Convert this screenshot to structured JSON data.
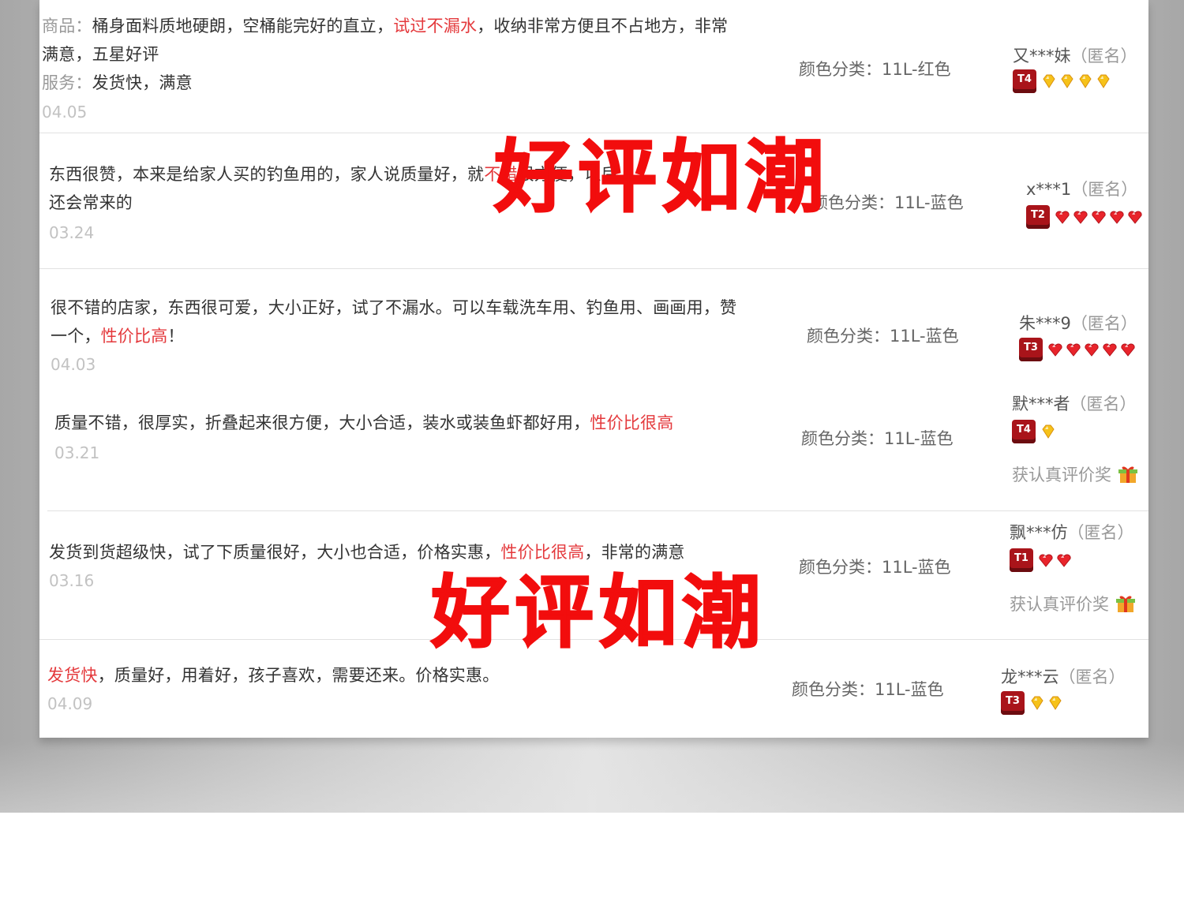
{
  "colors": {
    "highlight": "#e4393c",
    "watermark": "#f20d0d",
    "badge": "#a9141a",
    "gem_gold": "#f6c21a",
    "gem_red": "#e8242b"
  },
  "watermark_text": "好评如潮",
  "gift_label": "获认真评价奖",
  "reviews": [
    {
      "line1_a": "商品：",
      "line1_b": "桶身面料质地硬朗，空桶能完好的直立，",
      "line1_hl": "试过不漏水",
      "line1_c": "，收纳非常方便且不占地方，非常",
      "line2": "满意，五星好评",
      "service_label": "服务：",
      "service_text": "发货快，满意",
      "date": "04.05",
      "spec": "颜色分类：11L-红色",
      "user": "又***妹",
      "anon": "（匿名）",
      "level": "T4",
      "gem_icon": "gold-diamond-icon",
      "gem_count": 4
    },
    {
      "line1_a": "东西很赞，本来是给家人买的钓鱼用的，家人说质量好，就",
      "line1_hl": "不错",
      "line1_b": "很方便，以后",
      "line2": "还会常来的",
      "date": "03.24",
      "spec": "颜色分类：11L-蓝色",
      "user": "x***1",
      "anon": "（匿名）",
      "level": "T2",
      "gem_icon": "red-heart-gem-icon",
      "gem_count": 5
    },
    {
      "line1": "很不错的店家，东西很可爱，大小正好，试了不漏水。可以车载洗车用、钓鱼用、画画用，赞",
      "line2_a": "一个，",
      "line2_hl": "性价比高",
      "line2_b": "！",
      "date": "04.03",
      "spec": "颜色分类：11L-蓝色",
      "user": "朱***9",
      "anon": "（匿名）",
      "level": "T3",
      "gem_icon": "red-heart-gem-icon",
      "gem_count": 5
    },
    {
      "line1_a": "质量不错，很厚实，折叠起来很方便，大小合适，装水或装鱼虾都好用，",
      "line1_hl": "性价比很高",
      "date": "03.21",
      "spec": "颜色分类：11L-蓝色",
      "user": "默***者",
      "anon": "（匿名）",
      "level": "T4",
      "gem_icon": "gold-diamond-icon",
      "gem_count": 1
    },
    {
      "line1_a": "发货到货超级快，试了下质量很好，大小也合适，价格实惠，",
      "line1_hl": "性价比很高",
      "line1_b": "，非常的满意",
      "date": "03.16",
      "spec": "颜色分类：11L-蓝色",
      "user": "飘***仿",
      "anon": "（匿名）",
      "level": "T1",
      "gem_icon": "red-heart-gem-icon",
      "gem_count": 2
    },
    {
      "line1_hl": "发货快",
      "line1_b": "，质量好，用着好，孩子喜欢，需要还来。价格实惠。",
      "date": "04.09",
      "spec": "颜色分类：11L-蓝色",
      "user": "龙***云",
      "anon": "（匿名）",
      "level": "T3",
      "gem_icon": "gold-diamond-icon",
      "gem_count": 2
    }
  ]
}
